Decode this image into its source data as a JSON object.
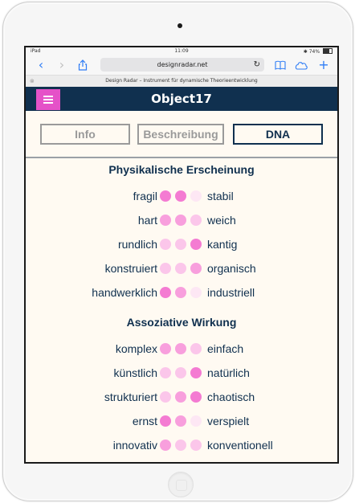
{
  "status": {
    "carrier": "iPad",
    "time": "11:09",
    "battery": "74%"
  },
  "browser": {
    "url": "designradar.net",
    "page_title": "Design Radar – Instrument für dynamische Theorieentwicklung"
  },
  "app": {
    "title": "Object17"
  },
  "tabs": [
    {
      "label": "Info",
      "active": false
    },
    {
      "label": "Beschreibung",
      "active": false
    },
    {
      "label": "DNA",
      "active": true
    }
  ],
  "sections": [
    {
      "title": "Physikalische Erscheinung",
      "rows": [
        {
          "left": "fragil",
          "right": "stabil",
          "dots": [
            3,
            3,
            0
          ]
        },
        {
          "left": "hart",
          "right": "weich",
          "dots": [
            2,
            2,
            1
          ]
        },
        {
          "left": "rundlich",
          "right": "kantig",
          "dots": [
            1,
            1,
            3
          ]
        },
        {
          "left": "konstruiert",
          "right": "organisch",
          "dots": [
            1,
            1,
            2
          ]
        },
        {
          "left": "handwerklich",
          "right": "industriell",
          "dots": [
            3,
            2,
            0
          ]
        }
      ]
    },
    {
      "title": "Assoziative Wirkung",
      "rows": [
        {
          "left": "komplex",
          "right": "einfach",
          "dots": [
            2,
            2,
            1
          ]
        },
        {
          "left": "künstlich",
          "right": "natürlich",
          "dots": [
            1,
            1,
            3
          ]
        },
        {
          "left": "strukturiert",
          "right": "chaotisch",
          "dots": [
            1,
            2,
            3
          ]
        },
        {
          "left": "ernst",
          "right": "verspielt",
          "dots": [
            3,
            2,
            0
          ]
        },
        {
          "left": "innovativ",
          "right": "konventionell",
          "dots": [
            2,
            1,
            1
          ]
        }
      ]
    }
  ],
  "colors": {
    "navy": "#10304f",
    "accent": "#e552c8"
  },
  "icons": [
    "back-icon",
    "forward-icon",
    "share-icon",
    "reload-icon",
    "reader-icon",
    "cloud-icon",
    "plus-icon",
    "menu-icon",
    "close-tab-icon"
  ]
}
